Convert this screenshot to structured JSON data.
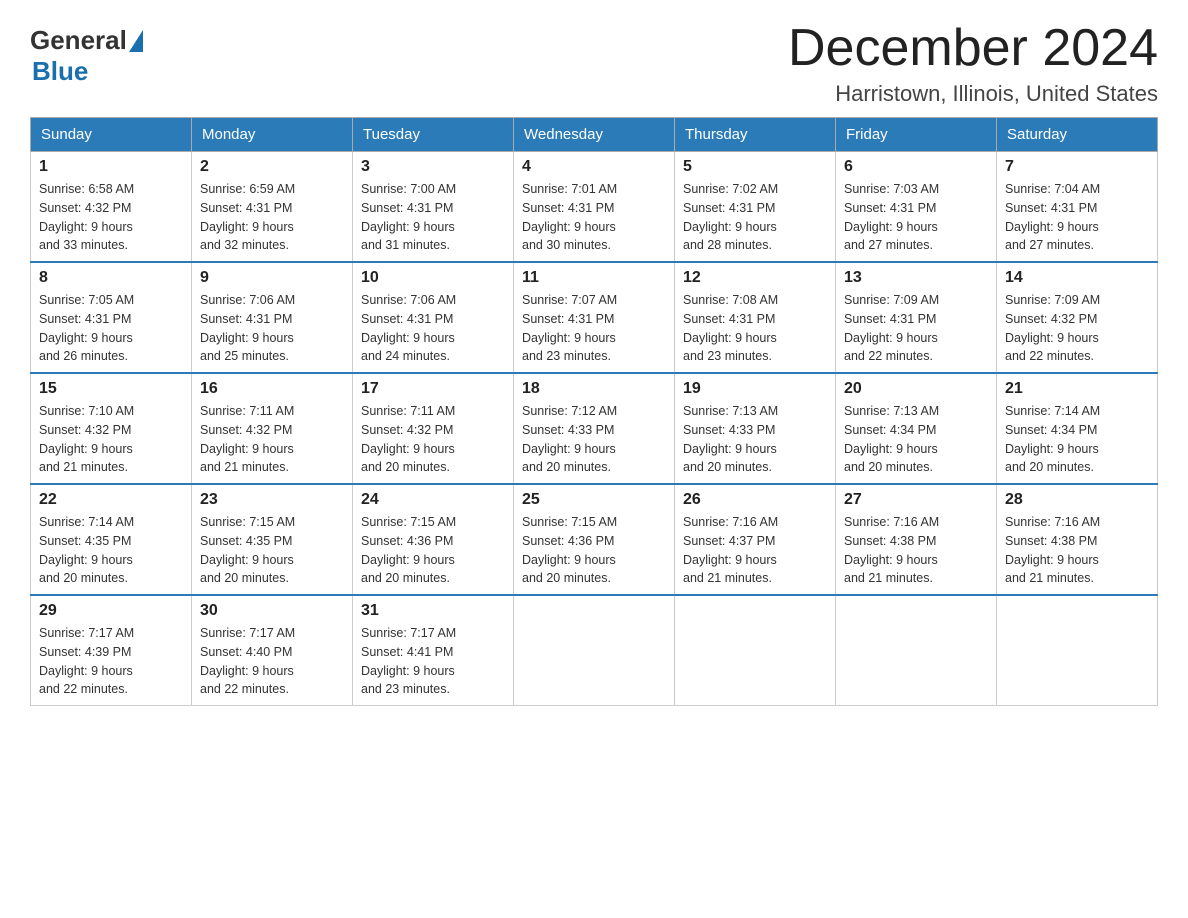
{
  "header": {
    "logo_general": "General",
    "logo_blue": "Blue",
    "month_title": "December 2024",
    "location": "Harristown, Illinois, United States"
  },
  "days_of_week": [
    "Sunday",
    "Monday",
    "Tuesday",
    "Wednesday",
    "Thursday",
    "Friday",
    "Saturday"
  ],
  "weeks": [
    [
      {
        "day": "1",
        "sunrise": "Sunrise: 6:58 AM",
        "sunset": "Sunset: 4:32 PM",
        "daylight": "Daylight: 9 hours",
        "daylight2": "and 33 minutes."
      },
      {
        "day": "2",
        "sunrise": "Sunrise: 6:59 AM",
        "sunset": "Sunset: 4:31 PM",
        "daylight": "Daylight: 9 hours",
        "daylight2": "and 32 minutes."
      },
      {
        "day": "3",
        "sunrise": "Sunrise: 7:00 AM",
        "sunset": "Sunset: 4:31 PM",
        "daylight": "Daylight: 9 hours",
        "daylight2": "and 31 minutes."
      },
      {
        "day": "4",
        "sunrise": "Sunrise: 7:01 AM",
        "sunset": "Sunset: 4:31 PM",
        "daylight": "Daylight: 9 hours",
        "daylight2": "and 30 minutes."
      },
      {
        "day": "5",
        "sunrise": "Sunrise: 7:02 AM",
        "sunset": "Sunset: 4:31 PM",
        "daylight": "Daylight: 9 hours",
        "daylight2": "and 28 minutes."
      },
      {
        "day": "6",
        "sunrise": "Sunrise: 7:03 AM",
        "sunset": "Sunset: 4:31 PM",
        "daylight": "Daylight: 9 hours",
        "daylight2": "and 27 minutes."
      },
      {
        "day": "7",
        "sunrise": "Sunrise: 7:04 AM",
        "sunset": "Sunset: 4:31 PM",
        "daylight": "Daylight: 9 hours",
        "daylight2": "and 27 minutes."
      }
    ],
    [
      {
        "day": "8",
        "sunrise": "Sunrise: 7:05 AM",
        "sunset": "Sunset: 4:31 PM",
        "daylight": "Daylight: 9 hours",
        "daylight2": "and 26 minutes."
      },
      {
        "day": "9",
        "sunrise": "Sunrise: 7:06 AM",
        "sunset": "Sunset: 4:31 PM",
        "daylight": "Daylight: 9 hours",
        "daylight2": "and 25 minutes."
      },
      {
        "day": "10",
        "sunrise": "Sunrise: 7:06 AM",
        "sunset": "Sunset: 4:31 PM",
        "daylight": "Daylight: 9 hours",
        "daylight2": "and 24 minutes."
      },
      {
        "day": "11",
        "sunrise": "Sunrise: 7:07 AM",
        "sunset": "Sunset: 4:31 PM",
        "daylight": "Daylight: 9 hours",
        "daylight2": "and 23 minutes."
      },
      {
        "day": "12",
        "sunrise": "Sunrise: 7:08 AM",
        "sunset": "Sunset: 4:31 PM",
        "daylight": "Daylight: 9 hours",
        "daylight2": "and 23 minutes."
      },
      {
        "day": "13",
        "sunrise": "Sunrise: 7:09 AM",
        "sunset": "Sunset: 4:31 PM",
        "daylight": "Daylight: 9 hours",
        "daylight2": "and 22 minutes."
      },
      {
        "day": "14",
        "sunrise": "Sunrise: 7:09 AM",
        "sunset": "Sunset: 4:32 PM",
        "daylight": "Daylight: 9 hours",
        "daylight2": "and 22 minutes."
      }
    ],
    [
      {
        "day": "15",
        "sunrise": "Sunrise: 7:10 AM",
        "sunset": "Sunset: 4:32 PM",
        "daylight": "Daylight: 9 hours",
        "daylight2": "and 21 minutes."
      },
      {
        "day": "16",
        "sunrise": "Sunrise: 7:11 AM",
        "sunset": "Sunset: 4:32 PM",
        "daylight": "Daylight: 9 hours",
        "daylight2": "and 21 minutes."
      },
      {
        "day": "17",
        "sunrise": "Sunrise: 7:11 AM",
        "sunset": "Sunset: 4:32 PM",
        "daylight": "Daylight: 9 hours",
        "daylight2": "and 20 minutes."
      },
      {
        "day": "18",
        "sunrise": "Sunrise: 7:12 AM",
        "sunset": "Sunset: 4:33 PM",
        "daylight": "Daylight: 9 hours",
        "daylight2": "and 20 minutes."
      },
      {
        "day": "19",
        "sunrise": "Sunrise: 7:13 AM",
        "sunset": "Sunset: 4:33 PM",
        "daylight": "Daylight: 9 hours",
        "daylight2": "and 20 minutes."
      },
      {
        "day": "20",
        "sunrise": "Sunrise: 7:13 AM",
        "sunset": "Sunset: 4:34 PM",
        "daylight": "Daylight: 9 hours",
        "daylight2": "and 20 minutes."
      },
      {
        "day": "21",
        "sunrise": "Sunrise: 7:14 AM",
        "sunset": "Sunset: 4:34 PM",
        "daylight": "Daylight: 9 hours",
        "daylight2": "and 20 minutes."
      }
    ],
    [
      {
        "day": "22",
        "sunrise": "Sunrise: 7:14 AM",
        "sunset": "Sunset: 4:35 PM",
        "daylight": "Daylight: 9 hours",
        "daylight2": "and 20 minutes."
      },
      {
        "day": "23",
        "sunrise": "Sunrise: 7:15 AM",
        "sunset": "Sunset: 4:35 PM",
        "daylight": "Daylight: 9 hours",
        "daylight2": "and 20 minutes."
      },
      {
        "day": "24",
        "sunrise": "Sunrise: 7:15 AM",
        "sunset": "Sunset: 4:36 PM",
        "daylight": "Daylight: 9 hours",
        "daylight2": "and 20 minutes."
      },
      {
        "day": "25",
        "sunrise": "Sunrise: 7:15 AM",
        "sunset": "Sunset: 4:36 PM",
        "daylight": "Daylight: 9 hours",
        "daylight2": "and 20 minutes."
      },
      {
        "day": "26",
        "sunrise": "Sunrise: 7:16 AM",
        "sunset": "Sunset: 4:37 PM",
        "daylight": "Daylight: 9 hours",
        "daylight2": "and 21 minutes."
      },
      {
        "day": "27",
        "sunrise": "Sunrise: 7:16 AM",
        "sunset": "Sunset: 4:38 PM",
        "daylight": "Daylight: 9 hours",
        "daylight2": "and 21 minutes."
      },
      {
        "day": "28",
        "sunrise": "Sunrise: 7:16 AM",
        "sunset": "Sunset: 4:38 PM",
        "daylight": "Daylight: 9 hours",
        "daylight2": "and 21 minutes."
      }
    ],
    [
      {
        "day": "29",
        "sunrise": "Sunrise: 7:17 AM",
        "sunset": "Sunset: 4:39 PM",
        "daylight": "Daylight: 9 hours",
        "daylight2": "and 22 minutes."
      },
      {
        "day": "30",
        "sunrise": "Sunrise: 7:17 AM",
        "sunset": "Sunset: 4:40 PM",
        "daylight": "Daylight: 9 hours",
        "daylight2": "and 22 minutes."
      },
      {
        "day": "31",
        "sunrise": "Sunrise: 7:17 AM",
        "sunset": "Sunset: 4:41 PM",
        "daylight": "Daylight: 9 hours",
        "daylight2": "and 23 minutes."
      },
      null,
      null,
      null,
      null
    ]
  ]
}
